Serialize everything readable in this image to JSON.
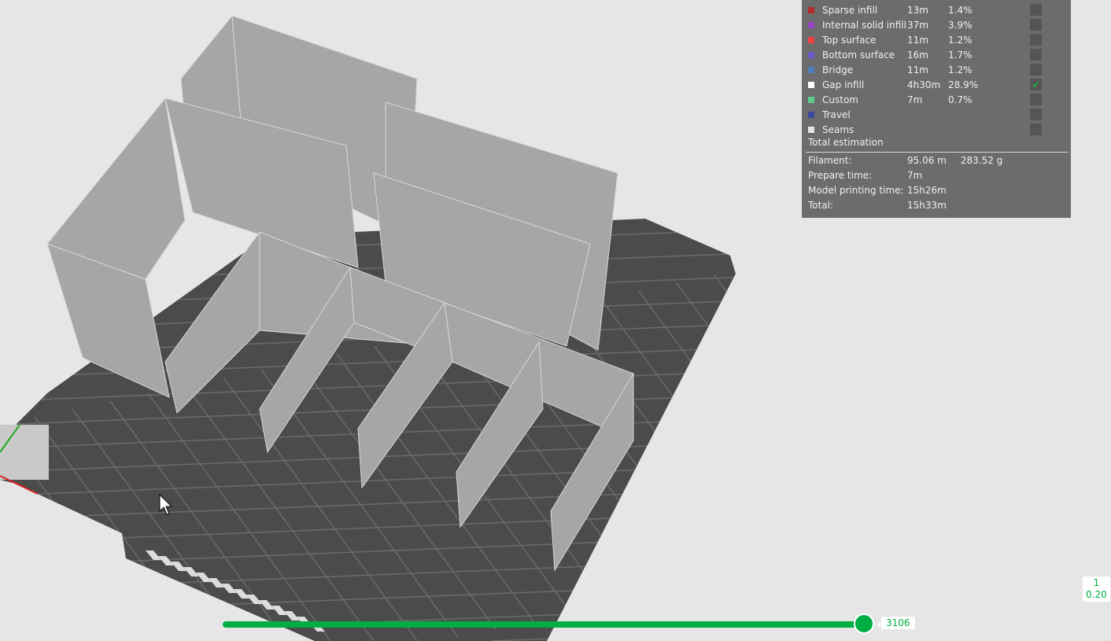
{
  "legend": {
    "rows": [
      {
        "name": "Sparse infill",
        "time": "13m",
        "percent": "1.4%",
        "color": "#b22a2a",
        "checked": false
      },
      {
        "name": "Internal solid infill",
        "time": "37m",
        "percent": "3.9%",
        "color": "#9b45c8",
        "checked": false
      },
      {
        "name": "Top surface",
        "time": "11m",
        "percent": "1.2%",
        "color": "#f04040",
        "checked": false
      },
      {
        "name": "Bottom surface",
        "time": "16m",
        "percent": "1.7%",
        "color": "#6a5acd",
        "checked": false
      },
      {
        "name": "Bridge",
        "time": "11m",
        "percent": "1.2%",
        "color": "#4d80c0",
        "checked": false
      },
      {
        "name": "Gap infill",
        "time": "4h30m",
        "percent": "28.9%",
        "color": "#ffffff",
        "checked": true
      },
      {
        "name": "Custom",
        "time": "7m",
        "percent": "0.7%",
        "color": "#5ecb8a",
        "checked": false
      },
      {
        "name": "Travel",
        "time": "",
        "percent": "",
        "color": "#3848a0",
        "checked": false
      },
      {
        "name": "Seams",
        "time": "",
        "percent": "",
        "color": "#e6e6e6",
        "checked": false
      }
    ],
    "total_title": "Total estimation",
    "filament_label": "Filament:",
    "filament_length": "95.06 m",
    "filament_weight": "283.52 g",
    "prepare_label": "Prepare time:",
    "prepare_value": "7m",
    "model_label": "Model printing time:",
    "model_value": "15h26m",
    "total_label": "Total:",
    "total_value": "15h33m"
  },
  "slider": {
    "value": "3106",
    "fraction": 1.0
  },
  "layer": {
    "number": "1",
    "height": "0.20"
  },
  "colors": {
    "accent": "#00ae42",
    "plate": "#4a4b4a",
    "wall": "#a9a9a9"
  }
}
